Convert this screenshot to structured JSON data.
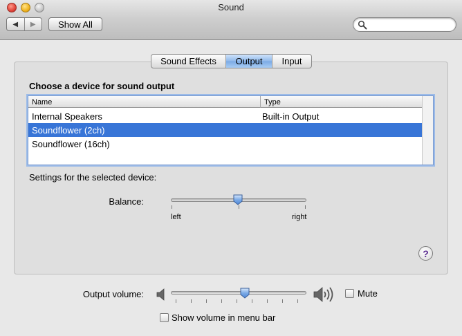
{
  "window": {
    "title": "Sound"
  },
  "toolbar": {
    "back_glyph": "◀",
    "forward_glyph": "▶",
    "show_all_label": "Show All",
    "search_placeholder": ""
  },
  "tabs": [
    {
      "label": "Sound Effects",
      "active": false
    },
    {
      "label": "Output",
      "active": true
    },
    {
      "label": "Input",
      "active": false
    }
  ],
  "output": {
    "choose_label": "Choose a device for sound output",
    "columns": {
      "name": "Name",
      "type": "Type"
    },
    "devices": [
      {
        "name": "Internal Speakers",
        "type": "Built-in Output",
        "selected": false
      },
      {
        "name": "Soundflower (2ch)",
        "type": "",
        "selected": true
      },
      {
        "name": "Soundflower (16ch)",
        "type": "",
        "selected": false
      }
    ],
    "settings_label": "Settings for the selected device:",
    "balance": {
      "label": "Balance:",
      "left_label": "left",
      "right_label": "right",
      "value": 0.5
    },
    "help_label": "?"
  },
  "volume": {
    "label": "Output volume:",
    "value": 0.55,
    "mute_label": "Mute",
    "mute_checked": false,
    "show_in_menu_bar_label": "Show volume in menu bar",
    "show_in_menu_bar_checked": false
  },
  "colors": {
    "selection": "#3875d7",
    "tab_active": "#8fb8ea",
    "help_glyph": "#5c2d91"
  }
}
